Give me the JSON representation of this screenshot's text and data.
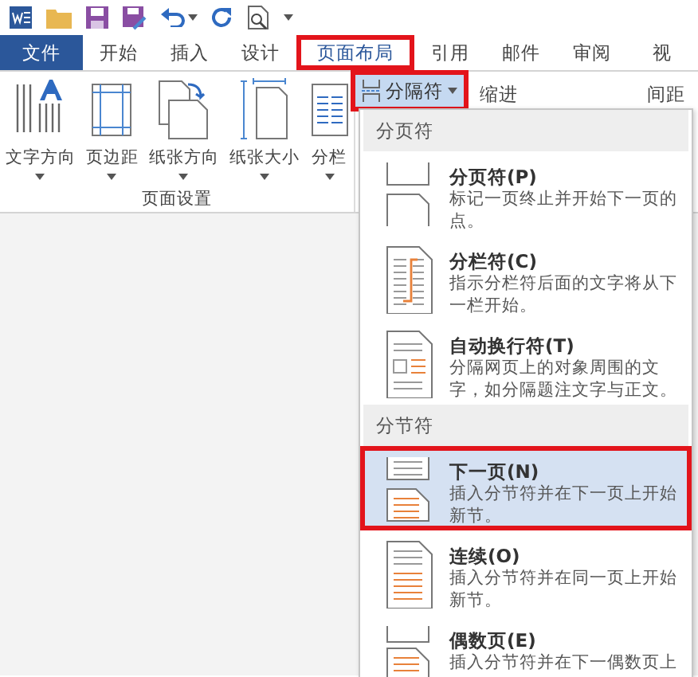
{
  "tabs": [
    {
      "label": "文件",
      "kind": "file",
      "selected": false
    },
    {
      "label": "开始",
      "kind": "tab",
      "selected": false
    },
    {
      "label": "插入",
      "kind": "tab",
      "selected": false
    },
    {
      "label": "设计",
      "kind": "tab",
      "selected": false
    },
    {
      "label": "页面布局",
      "kind": "tab",
      "selected": true
    },
    {
      "label": "引用",
      "kind": "tab",
      "selected": false
    },
    {
      "label": "邮件",
      "kind": "tab",
      "selected": false
    },
    {
      "label": "审阅",
      "kind": "tab",
      "selected": false
    },
    {
      "label": "视",
      "kind": "tab",
      "selected": false
    }
  ],
  "ribbon": {
    "group_label": "页面设置",
    "buttons": [
      {
        "label": "文字方向",
        "kind": "direction"
      },
      {
        "label": "页边距",
        "kind": "margins"
      },
      {
        "label": "纸张方向",
        "kind": "orientation"
      },
      {
        "label": "纸张大小",
        "kind": "size"
      },
      {
        "label": "分栏",
        "kind": "columns"
      }
    ],
    "breaks_button": {
      "label": "分隔符",
      "open": true
    },
    "indent_label": "缩进",
    "spacing_label": "间距"
  },
  "menu": {
    "sections": [
      {
        "title": "分页符",
        "items": [
          {
            "kind": "page",
            "title": "分页符(P)",
            "description": "标记一页终止并开始下一页的点。",
            "selected": false
          },
          {
            "kind": "column",
            "title": "分栏符(C)",
            "description": "指示分栏符后面的文字将从下一栏开始。",
            "selected": false
          },
          {
            "kind": "wrap",
            "title": "自动换行符(T)",
            "description": "分隔网页上的对象周围的文字，如分隔题注文字与正文。",
            "selected": false
          }
        ]
      },
      {
        "title": "分节符",
        "items": [
          {
            "kind": "nextpage",
            "title": "下一页(N)",
            "description": "插入分节符并在下一页上开始新节。",
            "selected": true
          },
          {
            "kind": "continuous",
            "title": "连续(O)",
            "description": "插入分节符并在同一页上开始新节。",
            "selected": false
          },
          {
            "kind": "evenpage",
            "title": "偶数页(E)",
            "description": "插入分节符并在下一偶数页上",
            "selected": false
          }
        ]
      }
    ]
  }
}
